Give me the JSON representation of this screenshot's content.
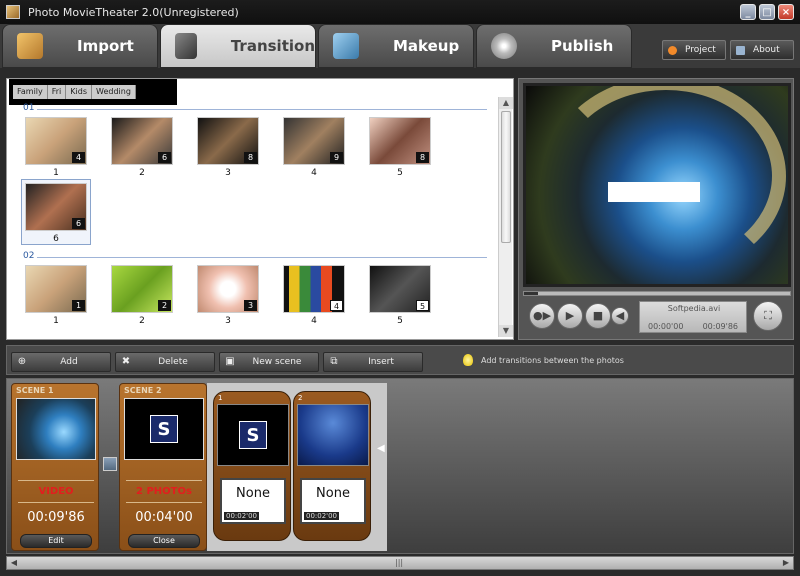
{
  "window": {
    "title": "Photo MovieTheater 2.0(Unregistered)",
    "minimize": "_",
    "maximize": "□",
    "close": "×"
  },
  "tabs": [
    {
      "label": "Import",
      "icon": "import-icon"
    },
    {
      "label": "Transition",
      "icon": "transition-icon"
    },
    {
      "label": "Makeup",
      "icon": "makeup-icon"
    },
    {
      "label": "Publish",
      "icon": "publish-icon"
    }
  ],
  "active_tab": "Transition",
  "top_buttons": {
    "project": "Project",
    "about": "About"
  },
  "category_tabs": [
    "Family",
    "Fri",
    "Kids",
    "Wedding"
  ],
  "groups": [
    {
      "label": "01",
      "items": [
        {
          "num": "1",
          "count": "4"
        },
        {
          "num": "2",
          "count": "6"
        },
        {
          "num": "3",
          "count": "8"
        },
        {
          "num": "4",
          "count": "9"
        },
        {
          "num": "5",
          "count": "8"
        },
        {
          "num": "6",
          "count": "6"
        }
      ]
    },
    {
      "label": "02",
      "items": [
        {
          "num": "1",
          "count": "1"
        },
        {
          "num": "2",
          "count": "2"
        },
        {
          "num": "3",
          "count": "3"
        },
        {
          "num": "4",
          "count": "4"
        },
        {
          "num": "5",
          "count": "5"
        }
      ]
    }
  ],
  "preview": {
    "filename": "Softpedia.avi",
    "time_current": "00:00'00",
    "time_total": "00:09'86"
  },
  "actions": {
    "add": "Add",
    "delete": "Delete",
    "new_scene": "New scene",
    "insert": "Insert",
    "hint": "Add transitions between the photos"
  },
  "scenes": [
    {
      "label": "SCENE 1",
      "type": "VIDEO",
      "duration": "00:09'86",
      "button": "Edit"
    },
    {
      "label": "SCENE 2",
      "type": "2 PHOTOs",
      "duration": "00:04'00",
      "button": "Close"
    }
  ],
  "photos": [
    {
      "num": "1",
      "transition": "None",
      "time": "00:02'00"
    },
    {
      "num": "2",
      "transition": "None",
      "time": "00:02'00"
    }
  ],
  "colors": {
    "accent": "#b8742e",
    "scene_type": "#e21e1e",
    "group_label": "#2c5aa0"
  }
}
